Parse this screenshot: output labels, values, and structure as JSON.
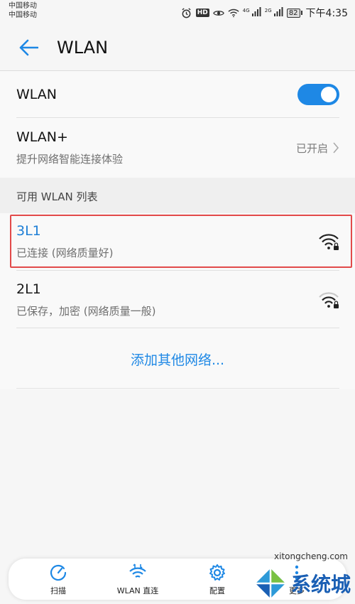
{
  "status_bar": {
    "carrier_1": "中国移动",
    "carrier_2": "中国移动",
    "hd": "HD",
    "net1": "4G",
    "net2": "2G",
    "battery": "82",
    "time": "下午4:35"
  },
  "app_bar": {
    "title": "WLAN"
  },
  "wlan_toggle": {
    "label": "WLAN",
    "on": true
  },
  "wlan_plus": {
    "title": "WLAN+",
    "subtitle": "提升网络智能连接体验",
    "status": "已开启"
  },
  "section_header": "可用 WLAN 列表",
  "networks": [
    {
      "name": "3L1",
      "status": "已连接 (网络质量好)",
      "signal": "strong-lock"
    },
    {
      "name": "2L1",
      "status": "已保存，加密 (网络质量一般)",
      "signal": "medium-lock"
    }
  ],
  "add_network": "添加其他网络...",
  "toolbar": [
    {
      "label": "扫描",
      "icon": "refresh-icon"
    },
    {
      "label": "WLAN 直连",
      "icon": "wifi-direct-icon"
    },
    {
      "label": "配置",
      "icon": "gear-icon"
    },
    {
      "label": "更多",
      "icon": "more-icon"
    }
  ],
  "watermark": {
    "brand": "系统城",
    "url": "xitongcheng.com"
  },
  "colors": {
    "accent": "#1e88e5",
    "highlight": "#e24a4a"
  }
}
